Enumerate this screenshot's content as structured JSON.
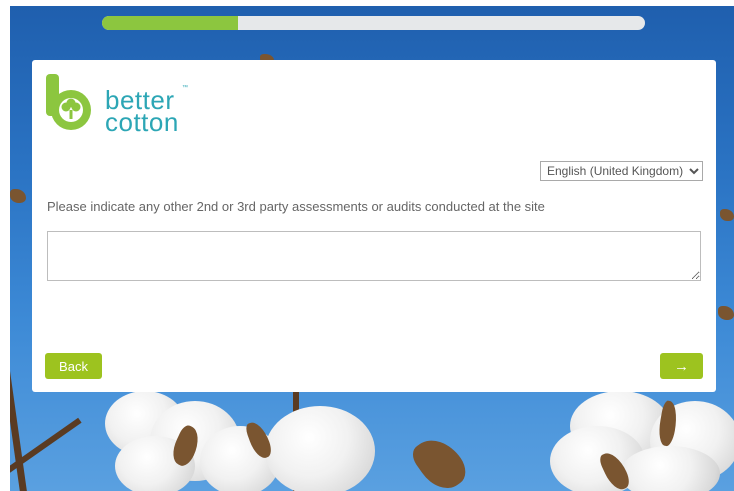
{
  "progress": {
    "fraction": 0.25
  },
  "logo": {
    "line1": "better",
    "line2": "cotton",
    "tm": "™"
  },
  "language": {
    "selected": "English (United Kingdom)"
  },
  "question": {
    "text": "Please indicate any other 2nd or 3rd party assessments or audits conducted at the site"
  },
  "answer": {
    "value": ""
  },
  "buttons": {
    "back": "Back",
    "next": "→"
  },
  "colors": {
    "accent": "#9dc31f",
    "progress": "#8cc63f",
    "logo_green": "#8cc63f",
    "logo_blue": "#2ca6b5"
  }
}
